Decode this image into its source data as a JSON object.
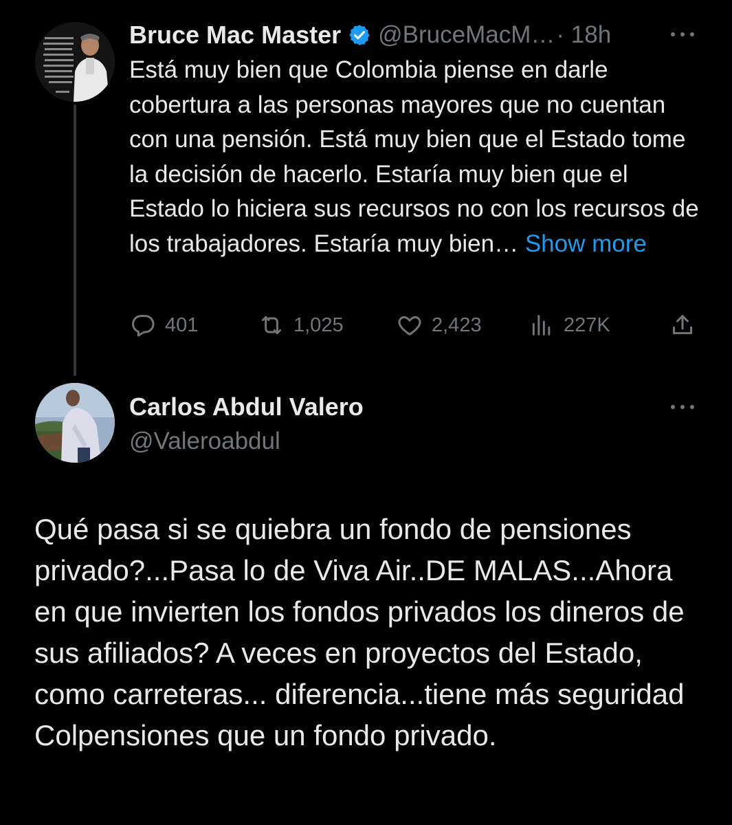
{
  "colors": {
    "background": "#000000",
    "text": "#e7e9ea",
    "secondary": "#71767b",
    "link": "#1d9bf0",
    "verified": "#1d9bf0"
  },
  "tweet1": {
    "author_name": "Bruce Mac Master",
    "handle": "@BruceMacM…",
    "time": "· 18h",
    "verified_icon": "verified-badge-icon",
    "text": "Está muy bien que Colombia piense en darle cobertura a las personas mayores que no cuentan con una pensión. Está muy bien que el Estado tome la decisión de hacerlo. Estaría muy bien que el Estado lo hiciera sus recursos no con los recursos de los trabajadores. Estaría muy bien… ",
    "show_more": "Show more",
    "stats": {
      "replies": "401",
      "retweets": "1,025",
      "likes": "2,423",
      "views": "227K"
    }
  },
  "tweet2": {
    "author_name": "Carlos Abdul Valero",
    "handle": "@Valeroabdul",
    "text": "Qué pasa si se quiebra un fondo de pensiones privado?...Pasa lo de Viva Air..DE MALAS...Ahora en que invierten los fondos privados los dineros de sus afiliados? A veces en proyectos del Estado, como carreteras... diferencia...tiene más seguridad Colpensiones que un fondo privado."
  }
}
